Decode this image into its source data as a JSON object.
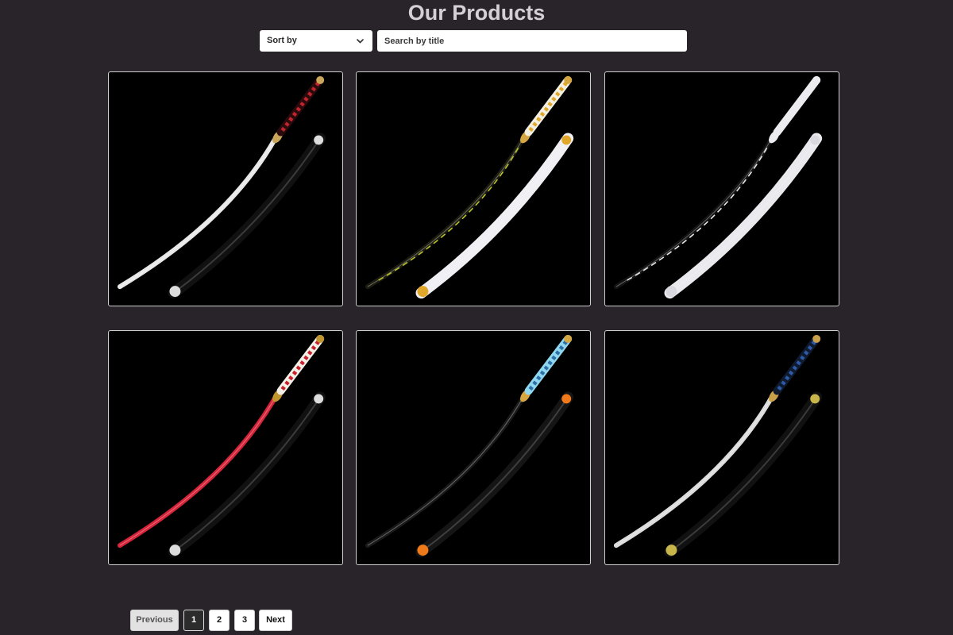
{
  "page": {
    "title": "Our Products"
  },
  "controls": {
    "sort_label": "Sort by",
    "sort_icon": "chevron-down-icon",
    "search_placeholder": "Search by title"
  },
  "products": [
    {
      "handle": "#2a0a0c",
      "wrap": "#c0242c",
      "guard": "#c9a65a",
      "blade": "#e8e8e8",
      "blade_accent": "",
      "scabbard": "#111111",
      "scabbard_end": "#dddddd"
    },
    {
      "handle": "#f3f0e2",
      "wrap": "#e0a82a",
      "guard": "#d6a640",
      "blade": "#1c1c10",
      "blade_accent": "#b8c22c",
      "scabbard": "#f0f0f4",
      "scabbard_end": "#e0a82a"
    },
    {
      "handle": "#ecebef",
      "wrap": "#ecebef",
      "guard": "#ecebef",
      "blade": "#141414",
      "blade_accent": "#e6e6e6",
      "scabbard": "#e9e9ee",
      "scabbard_end": "#d8d8de"
    },
    {
      "handle": "#f1efe6",
      "wrap": "#c8202c",
      "guard": "#c2962f",
      "blade": "#d6243a",
      "blade_accent": "",
      "scabbard": "#111111",
      "scabbard_end": "#dddddd"
    },
    {
      "handle": "#8fd6ef",
      "wrap": "#2e6fa8",
      "guard": "#d6a640",
      "blade": "#1a1a1a",
      "blade_accent": "",
      "scabbard": "#151515",
      "scabbard_end": "#f07a1a"
    },
    {
      "handle": "#0f1a2e",
      "wrap": "#2c5aa6",
      "guard": "#c9a04a",
      "blade": "#dcdcdc",
      "blade_accent": "",
      "scabbard": "#111111",
      "scabbard_end": "#c8b64a"
    }
  ],
  "pagination": {
    "prev_label": "Previous",
    "pages": [
      "1",
      "2",
      "3"
    ],
    "active": "1",
    "next_label": "Next"
  }
}
